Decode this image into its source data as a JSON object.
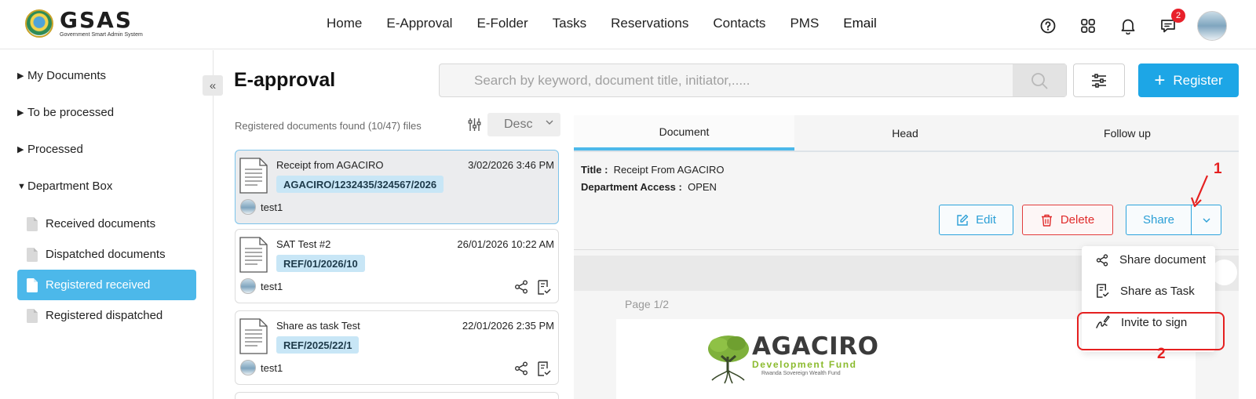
{
  "header": {
    "logo_text": "GSAS",
    "logo_subtitle": "Government Smart Admin System",
    "nav": [
      "Home",
      "E-Approval",
      "E-Folder",
      "Tasks",
      "Reservations",
      "Contacts",
      "PMS",
      "Email"
    ],
    "icons": [
      "help-icon",
      "apps-grid-icon",
      "bell-icon",
      "messages-icon"
    ],
    "messages_badge": "2"
  },
  "sidebar": {
    "sections": [
      {
        "label": "My Documents",
        "expanded": false
      },
      {
        "label": "To be processed",
        "expanded": false
      },
      {
        "label": "Processed",
        "expanded": false
      },
      {
        "label": "Department Box",
        "expanded": true
      }
    ],
    "items": [
      {
        "label": "Received documents",
        "active": false
      },
      {
        "label": "Dispatched documents",
        "active": false
      },
      {
        "label": "Registered received",
        "active": true
      },
      {
        "label": "Registered dispatched",
        "active": false
      }
    ],
    "collapse_label": "«"
  },
  "page": {
    "title": "E-approval",
    "search_placeholder": "Search by keyword, document title, initiator,.....",
    "register_label": "Register",
    "found_text": "Registered documents found (10/47) files",
    "sort_value": "Desc"
  },
  "documents": [
    {
      "title": "Receipt from AGACIRO",
      "date": "3/02/2026 3:46 PM",
      "ref": "AGACIRO/1232435/324567/2026",
      "user": "test1",
      "selected": true
    },
    {
      "title": "SAT Test #2",
      "date": "26/01/2026 10:22 AM",
      "ref": "REF/01/2026/10",
      "user": "test1",
      "selected": false
    },
    {
      "title": "Share as task Test",
      "date": "22/01/2026 2:35 PM",
      "ref": "REF/2025/22/1",
      "user": "test1",
      "selected": false
    }
  ],
  "detail": {
    "tabs": [
      "Document",
      "Head",
      "Follow up"
    ],
    "active_tab": "Document",
    "title_label": "Title :",
    "title_value": "Receipt From AGACIRO",
    "access_label": "Department Access :",
    "access_value": "OPEN",
    "edit_label": "Edit",
    "delete_label": "Delete",
    "share_label": "Share",
    "page_label": "Page 1/2",
    "preview": {
      "org_name": "AGACIRO",
      "org_sub": "Development Fund",
      "org_tagline": "Rwanda Sovereign Wealth Fund"
    }
  },
  "share_menu": {
    "items": [
      "Share document",
      "Share as Task",
      "Invite to sign"
    ]
  },
  "annotations": {
    "step1": "1",
    "step2": "2"
  },
  "colors": {
    "accent": "#1da6e6",
    "active_sidebar": "#4cb8ea",
    "danger": "#e02a2a",
    "annotation": "#e52020",
    "ref_badge": "#c8e6f6"
  }
}
